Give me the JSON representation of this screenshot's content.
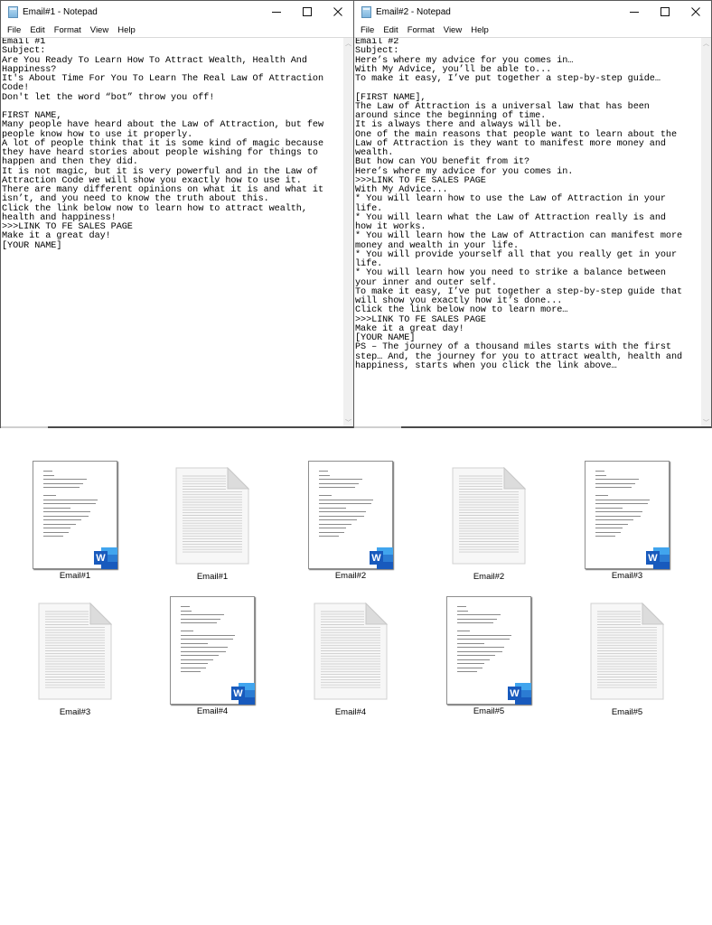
{
  "windows": [
    {
      "title": "Email#1 - Notepad",
      "menu": [
        "File",
        "Edit",
        "Format",
        "View",
        "Help"
      ],
      "lines": [
        "Email #1",
        "Subject:",
        "Are You Ready To Learn How To Attract Wealth, Health And",
        "Happiness?",
        "It's About Time For You To Learn The Real Law Of Attraction",
        "Code!",
        "Don't let the word “bot” throw you off!",
        "",
        "FIRST NAME,",
        "Many people have heard about the Law of Attraction, but few",
        "people know how to use it properly.",
        "A lot of people think that it is some kind of magic because",
        "they have heard stories about people wishing for things to",
        "happen and then they did.",
        "It is not magic, but it is very powerful and in the Law of",
        "Attraction Code we will show you exactly how to use it.",
        "There are many different opinions on what it is and what it",
        "isn’t, and you need to know the truth about this.",
        "Click the link below now to learn how to attract wealth,",
        "health and happiness!",
        ">>>LINK TO FE SALES PAGE",
        "Make it a great day!",
        "[YOUR NAME]"
      ]
    },
    {
      "title": "Email#2 - Notepad",
      "menu": [
        "File",
        "Edit",
        "Format",
        "View",
        "Help"
      ],
      "lines": [
        "Email #2",
        "Subject:",
        "Here’s where my advice for you comes in…",
        "With My Advice, you’ll be able to...",
        "To make it easy, I’ve put together a step-by-step guide…",
        "",
        "[FIRST NAME],",
        "The Law of Attraction is a universal law that has been",
        "around since the beginning of time.",
        "It is always there and always will be.",
        "One of the main reasons that people want to learn about the",
        "Law of Attraction is they want to manifest more money and",
        "wealth.",
        "But how can YOU benefit from it?",
        "Here’s where my advice for you comes in.",
        ">>>LINK TO FE SALES PAGE",
        "With My Advice...",
        "* You will learn how to use the Law of Attraction in your",
        "life.",
        "* You will learn what the Law of Attraction really is and",
        "how it works.",
        "* You will learn how the Law of Attraction can manifest more",
        "money and wealth in your life.",
        "* You will provide yourself all that you really get in your",
        "life.",
        "* You will learn how you need to strike a balance between",
        "your inner and outer self.",
        "To make it easy, I’ve put together a step-by-step guide that",
        "will show you exactly how it’s done...",
        "Click the link below now to learn more…",
        ">>>LINK TO FE SALES PAGE",
        "Make it a great day!",
        "[YOUR NAME]",
        "PS – The journey of a thousand miles starts with the first",
        "step… And, the journey for you to attract wealth, health and",
        "happiness, starts when you click the link above…"
      ]
    }
  ],
  "window_icons": {
    "app": "notepad-icon",
    "minimize": "minimize-icon",
    "maximize": "maximize-icon",
    "close": "close-icon"
  },
  "files": [
    {
      "name": "Email#1",
      "type": "word",
      "icon": "word-document-icon"
    },
    {
      "name": "Email#1",
      "type": "text",
      "icon": "text-document-icon"
    },
    {
      "name": "Email#2",
      "type": "word",
      "icon": "word-document-icon"
    },
    {
      "name": "Email#2",
      "type": "text",
      "icon": "text-document-icon"
    },
    {
      "name": "Email#3",
      "type": "word",
      "icon": "word-document-icon"
    },
    {
      "name": "Email#3",
      "type": "text",
      "icon": "text-document-icon"
    },
    {
      "name": "Email#4",
      "type": "word",
      "icon": "word-document-icon"
    },
    {
      "name": "Email#4",
      "type": "text",
      "icon": "text-document-icon"
    },
    {
      "name": "Email#5",
      "type": "word",
      "icon": "word-document-icon"
    },
    {
      "name": "Email#5",
      "type": "text",
      "icon": "text-document-icon"
    }
  ],
  "word_badge_letter": "W",
  "colors": {
    "word_dark": "#185abd",
    "word_mid": "#2b7cd3",
    "word_light": "#41a5ee"
  }
}
